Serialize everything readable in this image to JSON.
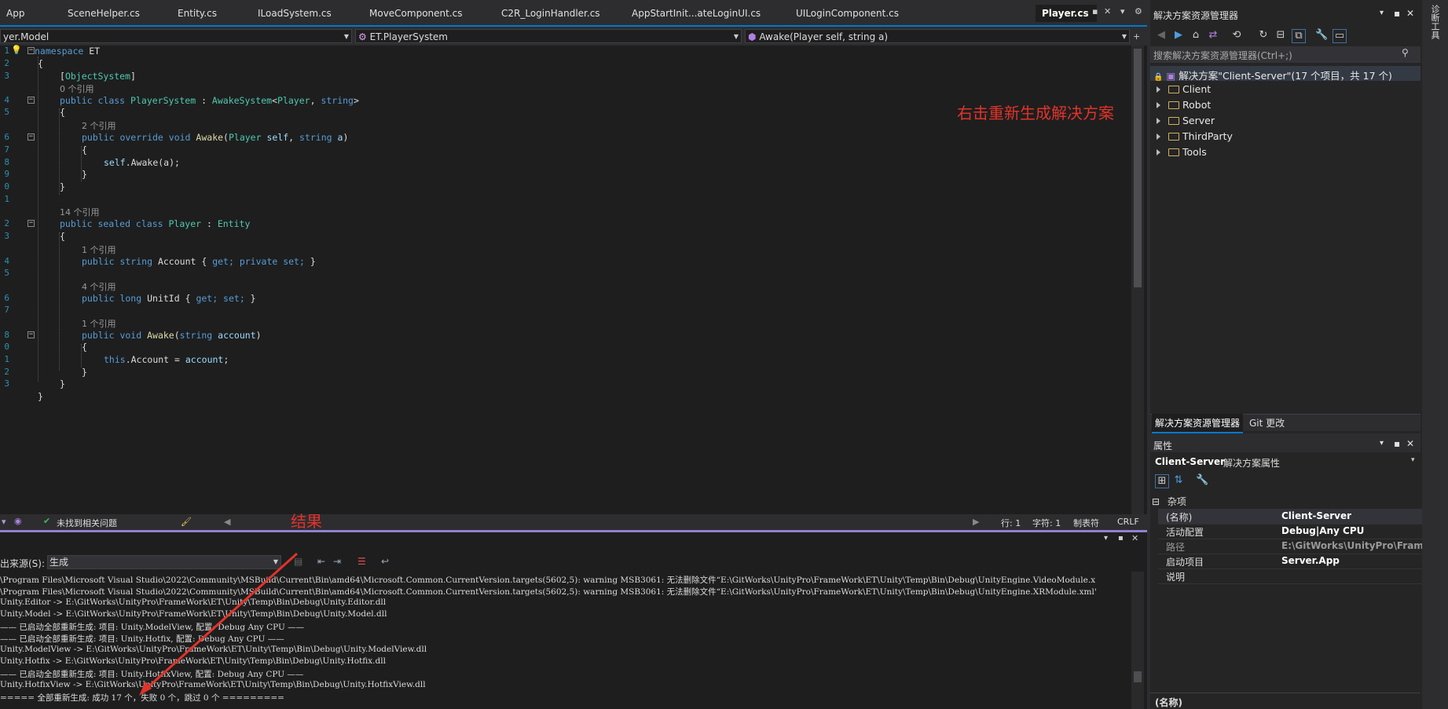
{
  "tabs": [
    "App",
    "SceneHelper.cs",
    "Entity.cs",
    "ILoadSystem.cs",
    "MoveComponent.cs",
    "C2R_LoginHandler.cs",
    "AppStartInit...ateLoginUI.cs",
    "UILoginComponent.cs",
    "Player.cs"
  ],
  "nav": {
    "project": "yer.Model",
    "class": "ET.PlayerSystem",
    "member": "Awake(Player self, string a)"
  },
  "code": {
    "line_numbers": [
      "1",
      "2",
      "3",
      "4",
      "5",
      "6",
      "7",
      "8",
      "9",
      "0",
      "1",
      "2",
      "3",
      "4",
      "5",
      "6",
      "7",
      "8",
      "0",
      "1",
      "2",
      "3"
    ],
    "l1": {
      "kw": "namespace",
      "name": " ET"
    },
    "l2": "{",
    "l3": {
      "attr": "ObjectSystem"
    },
    "lens1": "0 个引用",
    "l4": {
      "public": "public",
      "class": "class",
      "name": "PlayerSystem",
      "colon": " : ",
      "base": "AwakeSystem",
      "gen1": "Player",
      "gen2": "string"
    },
    "l5": "{",
    "lens2": "2 个引用",
    "l6": {
      "mods": "public override void",
      "fn": "Awake",
      "p1t": "Player",
      "p1": "self",
      "p2t": "string",
      "p2": "a"
    },
    "l7": "{",
    "l8": {
      "self": "self",
      "rest": ".Awake(a);"
    },
    "l9": "}",
    "l10": "}",
    "lens3": "14 个引用",
    "l11": {
      "mods": "public sealed class",
      "name": "Player",
      "base": "Entity"
    },
    "l12": "{",
    "lens4": "1 个引用",
    "l13": {
      "mods": "public string",
      "name": "Account",
      "acc": "get; private set;"
    },
    "lens5": "4 个引用",
    "l14": {
      "mods": "public long",
      "name": "UnitId",
      "acc": "get; set;"
    },
    "lens6": "1 个引用",
    "l15": {
      "mods": "public void",
      "fn": "Awake",
      "pt": "string",
      "p": "account"
    },
    "l16": "{",
    "l17": {
      "this": "this",
      "rest": ".Account = ",
      "val": "account",
      "end": ";"
    },
    "l18": "}",
    "l19": "}",
    "l20": "}"
  },
  "annotations": {
    "rebuild": "右击重新生成解决方案",
    "result": "结果"
  },
  "status": {
    "issues": "未找到相关问题",
    "line": "行: 1",
    "char": "字符: 1",
    "tab": "制表符",
    "eol": "CRLF"
  },
  "output": {
    "source_label": "出来源(S):",
    "source_value": "生成",
    "lines": [
      "\\Program Files\\Microsoft Visual Studio\\2022\\Community\\MSBuild\\Current\\Bin\\amd64\\Microsoft.Common.CurrentVersion.targets(5602,5): warning MSB3061: 无法删除文件“E:\\GitWorks\\UnityPro\\FrameWork\\ET\\Unity\\Temp\\Bin\\Debug\\UnityEngine.VideoModule.x",
      "\\Program Files\\Microsoft Visual Studio\\2022\\Community\\MSBuild\\Current\\Bin\\amd64\\Microsoft.Common.CurrentVersion.targets(5602,5): warning MSB3061: 无法删除文件“E:\\GitWorks\\UnityPro\\FrameWork\\ET\\Unity\\Temp\\Bin\\Debug\\UnityEngine.XRModule.xml'",
      "Unity.Editor -> E:\\GitWorks\\UnityPro\\FrameWork\\ET\\Unity\\Temp\\Bin\\Debug\\Unity.Editor.dll",
      "Unity.Model -> E:\\GitWorks\\UnityPro\\FrameWork\\ET\\Unity\\Temp\\Bin\\Debug\\Unity.Model.dll",
      "—— 已启动全部重新生成: 项目: Unity.ModelView, 配置: Debug Any CPU ——",
      "—— 已启动全部重新生成: 项目: Unity.Hotfix, 配置: Debug Any CPU ——",
      "Unity.ModelView -> E:\\GitWorks\\UnityPro\\FrameWork\\ET\\Unity\\Temp\\Bin\\Debug\\Unity.ModelView.dll",
      "Unity.Hotfix -> E:\\GitWorks\\UnityPro\\FrameWork\\ET\\Unity\\Temp\\Bin\\Debug\\Unity.Hotfix.dll",
      "—— 已启动全部重新生成: 项目: Unity.HotfixView, 配置: Debug Any CPU ——",
      "Unity.HotfixView -> E:\\GitWorks\\UnityPro\\FrameWork\\ET\\Unity\\Temp\\Bin\\Debug\\Unity.HotfixView.dll",
      "===== 全部重新生成: 成功 17 个，失败 0 个，跳过 0 个 ========="
    ]
  },
  "solution_explorer": {
    "title": "解决方案资源管理器",
    "search_placeholder": "搜索解决方案资源管理器(Ctrl+;)",
    "solution": "解决方案\"Client-Server\"(17 个项目，共 17 个)",
    "folders": [
      "Client",
      "Robot",
      "Server",
      "ThirdParty",
      "Tools"
    ],
    "tab_active": "解决方案资源管理器",
    "tab_other": "Git 更改"
  },
  "properties": {
    "title": "属性",
    "object_name": "Client-Server",
    "object_type": "解决方案属性",
    "category": "杂项",
    "rows": [
      {
        "key": "(名称)",
        "value": "Client-Server"
      },
      {
        "key": "活动配置",
        "value": "Debug|Any CPU"
      },
      {
        "key": "路径",
        "value": "E:\\GitWorks\\UnityPro\\Frame"
      },
      {
        "key": "启动项目",
        "value": "Server.App"
      },
      {
        "key": "说明",
        "value": ""
      }
    ],
    "footer": "(名称)"
  },
  "side_tab": "诊断工具"
}
